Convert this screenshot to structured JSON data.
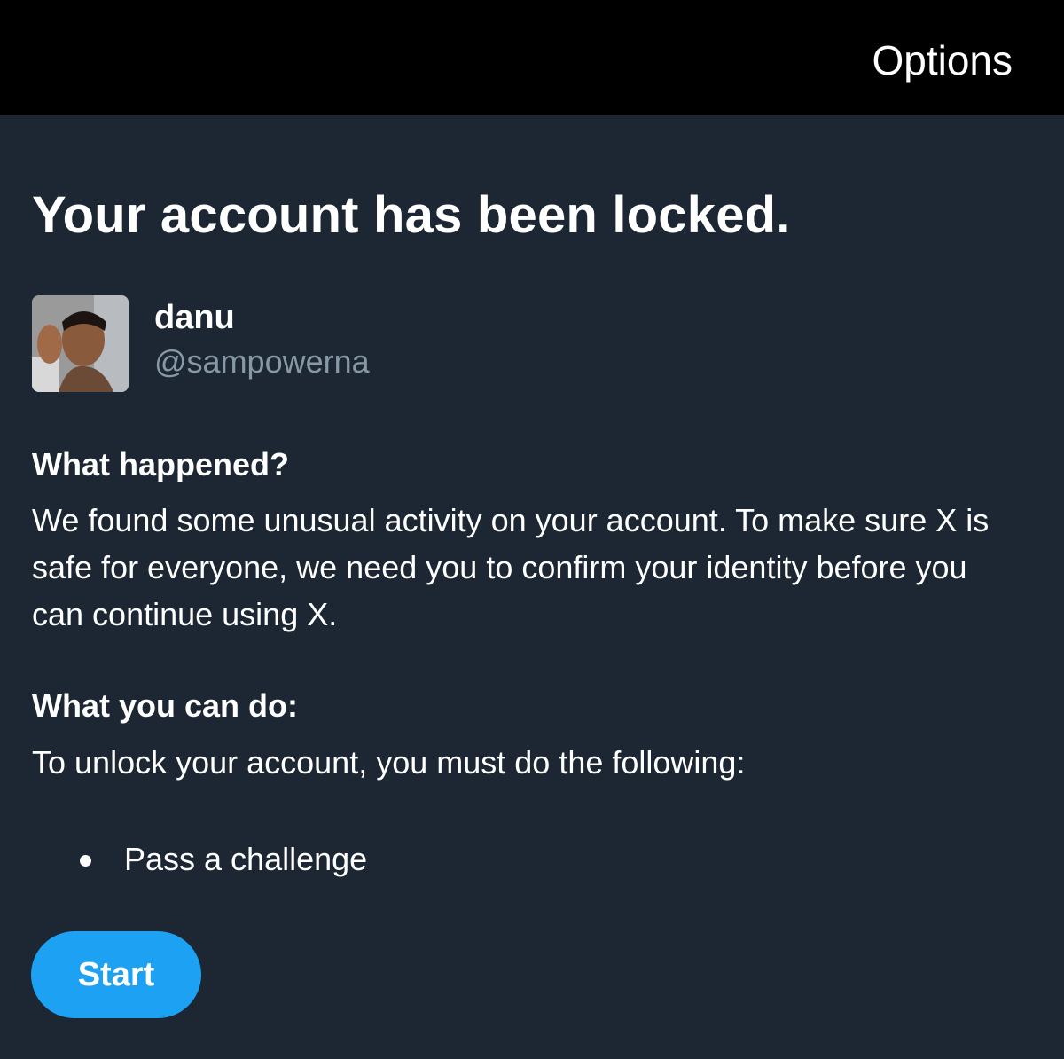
{
  "header": {
    "options_label": "Options"
  },
  "title": "Your account has been locked.",
  "user": {
    "display_name": "danu",
    "handle": "@sampowerna"
  },
  "what_happened": {
    "heading": "What happened?",
    "body": "We found some unusual activity on your account. To make sure X is safe for everyone, we need you to confirm your identity before you can continue using X."
  },
  "what_you_can_do": {
    "heading": "What you can do:",
    "body": "To unlock your account, you must do the following:",
    "steps": [
      "Pass a challenge"
    ]
  },
  "start_label": "Start",
  "colors": {
    "background": "#1c2733",
    "topbar": "#000000",
    "accent": "#1da1f2",
    "secondary_text": "#8899a6"
  }
}
